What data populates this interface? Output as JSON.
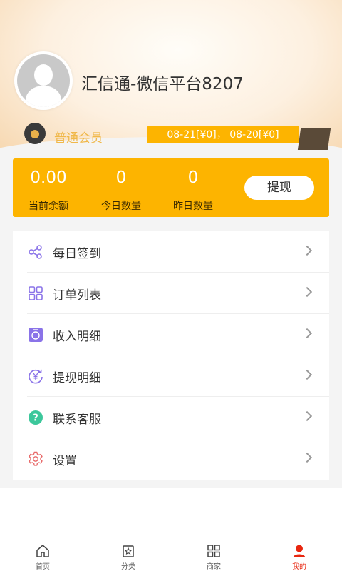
{
  "profile": {
    "username": "汇信通-微信平台8207",
    "member_level": "普通会员",
    "stats_tag": "08-21[¥0]， 08-20[¥0]"
  },
  "balance": {
    "current_value": "0.00",
    "current_label": "当前余额",
    "today_value": "0",
    "today_label": "今日数量",
    "yesterday_value": "0",
    "yesterday_label": "昨日数量",
    "withdraw_label": "提现"
  },
  "menu": {
    "items": [
      {
        "label": "每日签到",
        "icon": "share-icon"
      },
      {
        "label": "订单列表",
        "icon": "grid-icon"
      },
      {
        "label": "收入明细",
        "icon": "wallet-icon"
      },
      {
        "label": "提现明细",
        "icon": "yen-refresh-icon"
      },
      {
        "label": "联系客服",
        "icon": "help-icon"
      },
      {
        "label": "设置",
        "icon": "gear-icon"
      }
    ]
  },
  "tabbar": {
    "items": [
      {
        "label": "首页",
        "icon": "home-icon",
        "active": false
      },
      {
        "label": "分类",
        "icon": "category-icon",
        "active": false
      },
      {
        "label": "商家",
        "icon": "store-icon",
        "active": false
      },
      {
        "label": "我的",
        "icon": "user-icon",
        "active": true
      }
    ]
  },
  "colors": {
    "accent": "#fdb400",
    "active_tab": "#e8260f",
    "icon_purple": "#8a73e8",
    "icon_green": "#3cc79b",
    "icon_red": "#e86b6b"
  }
}
